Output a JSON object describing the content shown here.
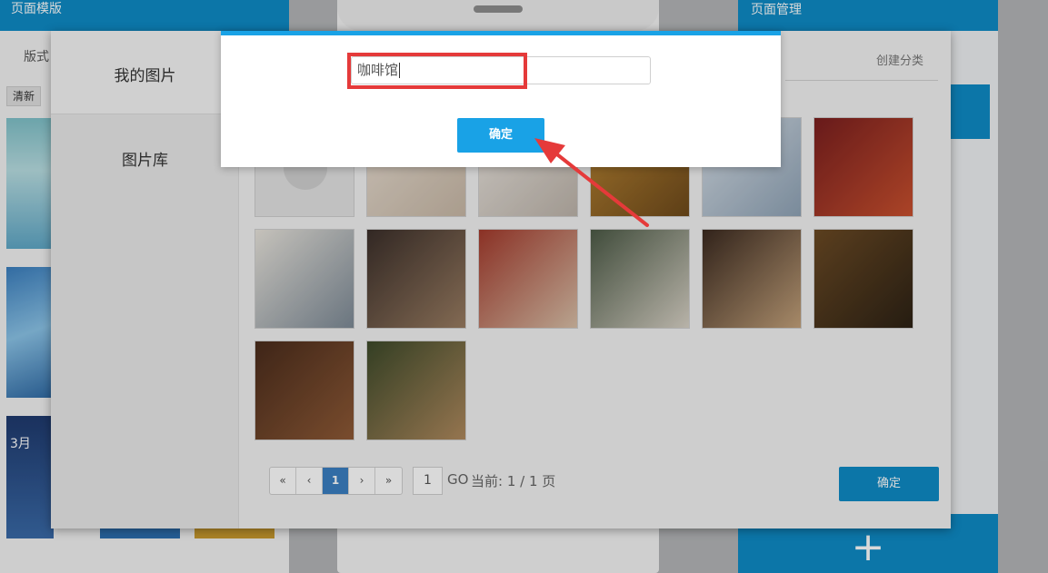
{
  "left_panel": {
    "title": "页面模版",
    "tab": "版式",
    "refresh_btn": "清新",
    "thumb3_text": "3月"
  },
  "right_panel": {
    "title": "页面管理",
    "add_label": "+"
  },
  "picker": {
    "side_items": [
      "我的图片",
      "图片库"
    ],
    "create_category": "创建分类",
    "pagination": {
      "first": "«",
      "prev": "‹",
      "current": "1",
      "next": "›",
      "last": "»"
    },
    "page_input": "1",
    "go_label": "GO",
    "page_info": "当前: 1 / 1 页",
    "confirm": "确定"
  },
  "dialog": {
    "input_value": "咖啡馆",
    "confirm": "确定"
  },
  "colors": {
    "accent": "#0f8bc6",
    "dialog_accent": "#19a2e6",
    "highlight": "#e53a3a",
    "page_active": "#3a7fc2"
  },
  "icons": [
    "play-icon",
    "arrow-annotation-icon"
  ]
}
